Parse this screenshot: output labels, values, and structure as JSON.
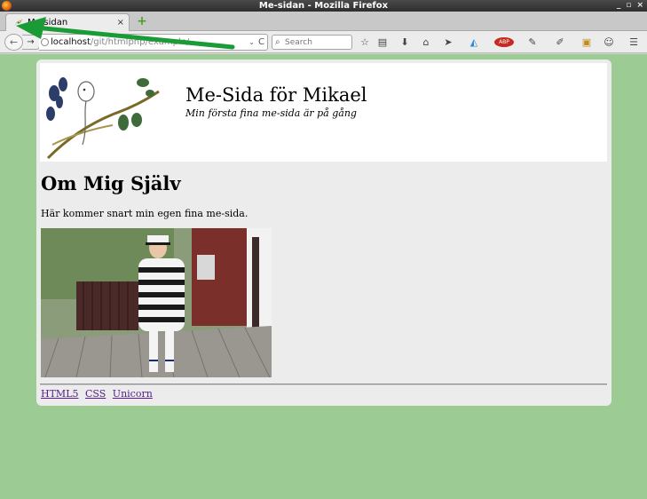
{
  "window": {
    "title": "Me-sidan - Mozilla Firefox",
    "controls": [
      "_",
      "▫",
      "×"
    ]
  },
  "tab": {
    "title": "Me-sidan",
    "close": "×",
    "new_tab": "+"
  },
  "nav": {
    "back": "←",
    "forward": "→",
    "url_host": "localhost",
    "url_path": "/git/htmlphp/example/...",
    "dropdown": "⌄",
    "reload": "C",
    "search_placeholder": "Search",
    "search_icon": "🔍"
  },
  "toolbar_icons": [
    {
      "name": "bookmark-star-icon",
      "glyph": "☆"
    },
    {
      "name": "reading-list-icon",
      "glyph": "▤"
    },
    {
      "name": "download-icon",
      "glyph": "⬇"
    },
    {
      "name": "home-icon",
      "glyph": "⌂"
    },
    {
      "name": "send-icon",
      "glyph": "➤"
    },
    {
      "name": "colorful-extension-icon",
      "glyph": "◭"
    },
    {
      "name": "adblock-icon",
      "glyph": "ABP"
    },
    {
      "name": "dropper-icon",
      "glyph": "✎"
    },
    {
      "name": "tools-icon",
      "glyph": "✐"
    },
    {
      "name": "screenshot-icon",
      "glyph": "▣"
    },
    {
      "name": "chat-icon",
      "glyph": "☺"
    },
    {
      "name": "menu-icon",
      "glyph": "☰"
    }
  ],
  "page": {
    "site_title": "Me-Sida för Mikael",
    "site_subtitle": "Min första fina me-sida är på gång",
    "heading": "Om Mig Själv",
    "paragraph": "Här kommer snart min egen fina me-sida.",
    "footer_links": [
      "HTML5",
      "CSS",
      "Unicorn"
    ]
  },
  "colors": {
    "page_background": "#9ccc93",
    "arrow": "#1a9b36",
    "link": "#551a8b"
  }
}
